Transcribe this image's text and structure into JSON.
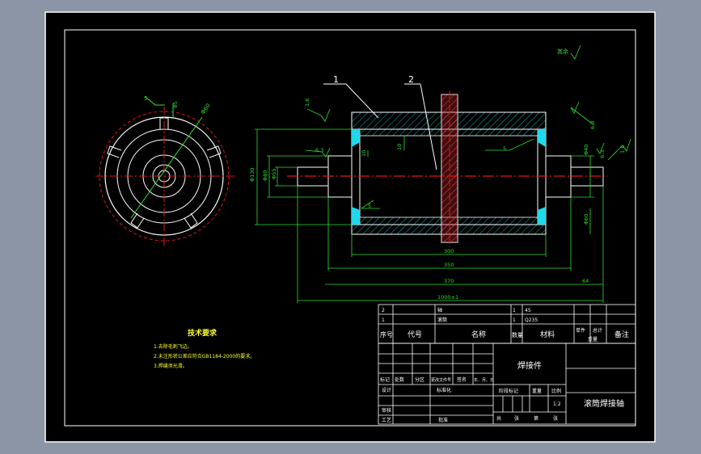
{
  "colors": {
    "outer_bg": "#8b95a5",
    "sheet": "#000000",
    "frame": "#ffffff",
    "green": "#2ee02e",
    "red": "#e01818",
    "cyan": "#20d8e8",
    "yellow": "#ffff00",
    "table_text": "#ffffff",
    "tech_text": "#ffff30"
  },
  "parts": {
    "balloon_1": "1",
    "balloon_2": "2"
  },
  "dimensions": {
    "d300": "300",
    "d350": "350",
    "d370": "370",
    "d64": "64",
    "d1000": "1000±1",
    "dia130": "Φ130",
    "dia80": "Φ80",
    "dia10": "10",
    "len10": "10",
    "dia55": "Φ55",
    "dia40": "Φ40",
    "chamfer5a": "5",
    "chamfer5b": "5",
    "chamfer5c": "5",
    "rough_a": "1.6",
    "rough_b": "6.3",
    "rough_c": "6.3",
    "rough_d": "6.3",
    "rough_e": "1.6",
    "rough_other": "其余",
    "side_dia": "Φ60",
    "side_chamfer": "5",
    "side_label": "Φ5"
  },
  "tech_requirements": {
    "title": "技术要求",
    "items": [
      "1.去除毛刺飞边。",
      "2.未注形状公差应符合GB1184-2000的要求。",
      "3.焊缝须光滑。"
    ]
  },
  "bom": {
    "rows": [
      {
        "no": "2",
        "code": "",
        "name": "轴",
        "qty": "1",
        "material": "45"
      },
      {
        "no": "1",
        "code": "",
        "name": "滚筒",
        "qty": "1",
        "material": "Q235"
      }
    ],
    "header": {
      "no": "序号",
      "code": "代号",
      "name": "名称",
      "qty": "数量",
      "material": "材料",
      "single": "单件",
      "total": "总计",
      "weight": "重量",
      "note": "备注"
    }
  },
  "title_block": {
    "part_type": "焊接件",
    "title": "滚筒焊接轴",
    "labels": {
      "mark": "标记",
      "count": "处数",
      "zone": "分区",
      "change_doc": "更改文件号",
      "sign": "签名",
      "date": "年、月、日",
      "design": "设计",
      "standard": "标准化",
      "stage_mark": "阶段标记",
      "weight": "重量",
      "scale": "比例",
      "review": "审核",
      "process": "工艺",
      "approve": "批准",
      "sheets_total": "共",
      "sheet_word": "张",
      "sheet_no": "第",
      "sheet_word2": "张"
    },
    "scale_value": "1:2"
  }
}
